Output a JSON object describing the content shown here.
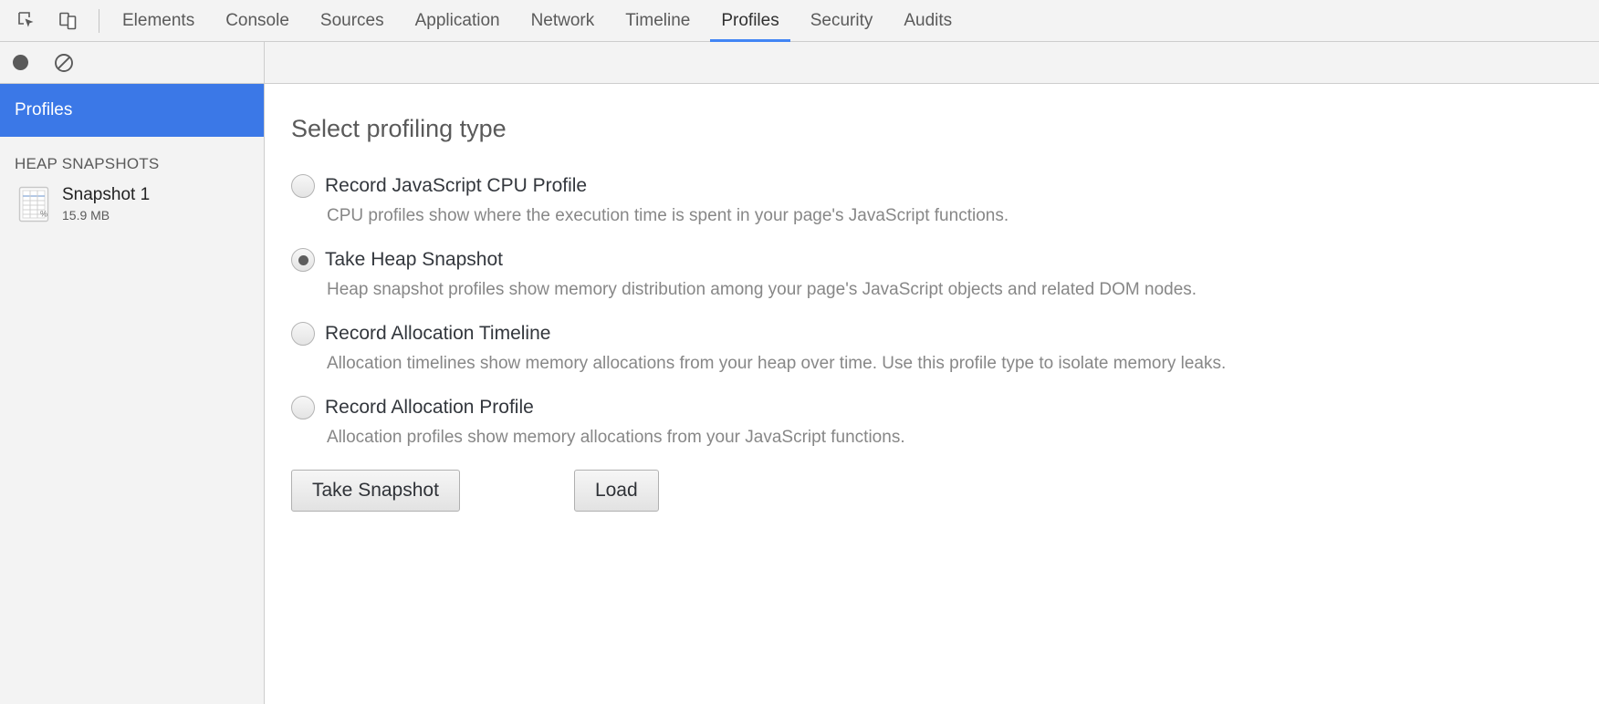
{
  "toolbar": {
    "inspect_icon": "inspect-element-icon",
    "device_icon": "device-toolbar-icon",
    "tabs": [
      {
        "label": "Elements",
        "active": false
      },
      {
        "label": "Console",
        "active": false
      },
      {
        "label": "Sources",
        "active": false
      },
      {
        "label": "Application",
        "active": false
      },
      {
        "label": "Network",
        "active": false
      },
      {
        "label": "Timeline",
        "active": false
      },
      {
        "label": "Profiles",
        "active": true
      },
      {
        "label": "Security",
        "active": false
      },
      {
        "label": "Audits",
        "active": false
      }
    ],
    "accent_color": "#4285f4"
  },
  "subtoolbar": {
    "record_icon": "record-circle-icon",
    "clear_icon": "clear-no-entry-icon"
  },
  "sidebar": {
    "header": "Profiles",
    "header_color": "#3b78e7",
    "section_label": "HEAP SNAPSHOTS",
    "snapshots": [
      {
        "icon": "heap-snapshot-grid-icon",
        "title": "Snapshot 1",
        "size": "15.9 MB"
      }
    ]
  },
  "main": {
    "title": "Select profiling type",
    "options": [
      {
        "label": "Record JavaScript CPU Profile",
        "description": "CPU profiles show where the execution time is spent in your page's JavaScript functions.",
        "selected": false
      },
      {
        "label": "Take Heap Snapshot",
        "description": "Heap snapshot profiles show memory distribution among your page's JavaScript objects and related DOM nodes.",
        "selected": true
      },
      {
        "label": "Record Allocation Timeline",
        "description": "Allocation timelines show memory allocations from your heap over time. Use this profile type to isolate memory leaks.",
        "selected": false
      },
      {
        "label": "Record Allocation Profile",
        "description": "Allocation profiles show memory allocations from your JavaScript functions.",
        "selected": false
      }
    ],
    "buttons": {
      "primary": "Take Snapshot",
      "secondary": "Load"
    }
  }
}
